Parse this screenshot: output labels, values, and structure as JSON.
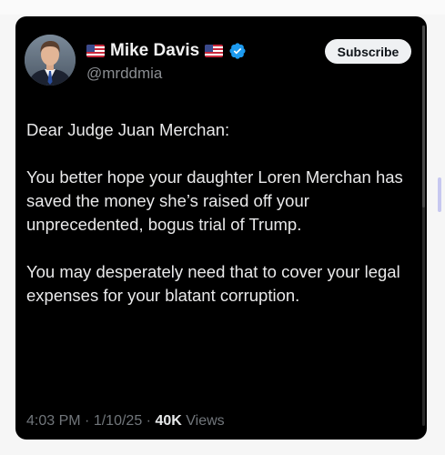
{
  "author": {
    "display_name": "Mike Davis",
    "handle": "@mrddmia",
    "flag_icon_left": "us-flag-icon",
    "flag_icon_right": "us-flag-icon",
    "verified_icon": "verified-badge-icon",
    "verified_color": "#1d9bf0"
  },
  "actions": {
    "subscribe_label": "Subscribe"
  },
  "tweet": {
    "paragraphs": [
      "Dear Judge Juan Merchan:",
      "You better hope your daughter Loren Merchan has saved the money she’s raised off your unprecedented, bogus trial of Trump.",
      "You may desperately need that to cover your legal expenses for your blatant corruption."
    ]
  },
  "meta": {
    "time": "4:03 PM",
    "separator": "·",
    "date": "1/10/25",
    "views_count": "40K",
    "views_label": "Views"
  },
  "colors": {
    "card_background": "#000000",
    "text_primary": "#e7e9ea",
    "text_secondary": "#71767b",
    "subscribe_bg": "#eff1f3"
  }
}
